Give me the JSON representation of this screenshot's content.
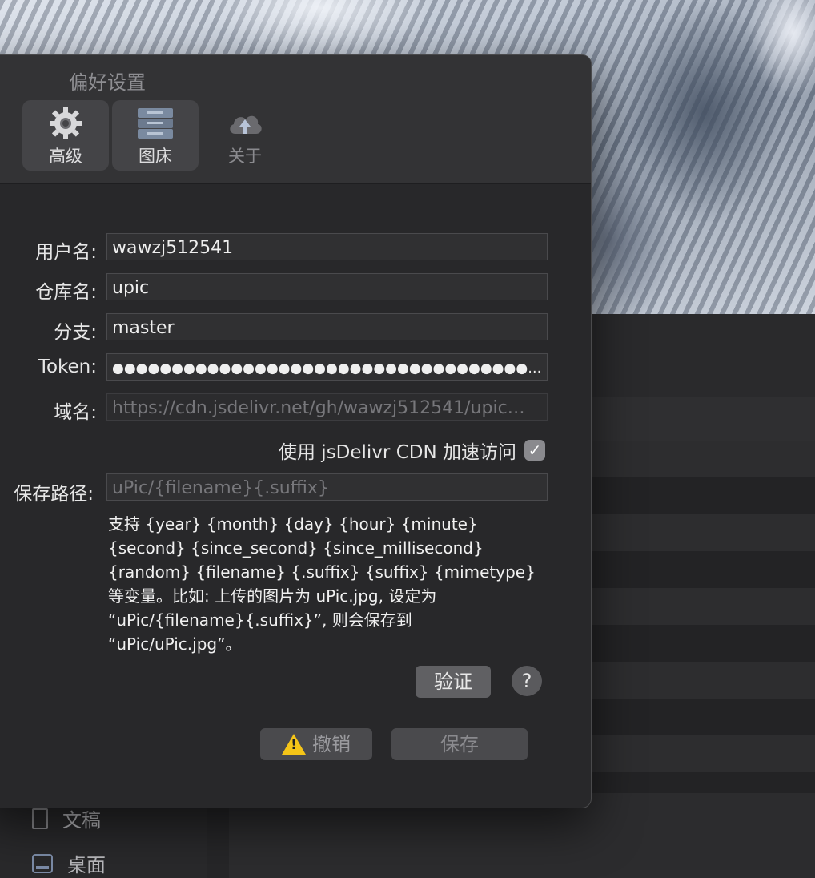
{
  "window": {
    "title": "偏好设置"
  },
  "toolbar": {
    "items": [
      {
        "label": "高级",
        "icon": "gear-icon",
        "selected": true
      },
      {
        "label": "图床",
        "icon": "server-icon",
        "selected": true
      },
      {
        "label": "关于",
        "icon": "cloud-upload-icon",
        "selected": false
      }
    ]
  },
  "form": {
    "username": {
      "label": "用户名:",
      "value": "wawzj512541"
    },
    "repo": {
      "label": "仓库名:",
      "value": "upic"
    },
    "branch": {
      "label": "分支:",
      "value": "master"
    },
    "token": {
      "label": "Token:",
      "value": "●●●●●●●●●●●●●●●●●●●●●●●●●●●●●●●●●●●●●●●●●●●●●●●●●"
    },
    "domain": {
      "label": "域名:",
      "placeholder": "https://cdn.jsdelivr.net/gh/wawzj512541/upic…"
    },
    "cdn": {
      "label": "使用 jsDelivr CDN 加速访问",
      "checked": true,
      "check_glyph": "✓"
    },
    "save_path": {
      "label": "保存路径:",
      "placeholder": "uPic/{filename}{.suffix}"
    },
    "help_text": "支持 {year} {month} {day} {hour} {minute} {second} {since_second} {since_millisecond} {random} {filename} {.suffix} {suffix} {mimetype} 等变量。比如: 上传的图片为 uPic.jpg, 设定为 “uPic/{filename}{.suffix}”, 则会保存到 “uPic/uPic.jpg”。"
  },
  "buttons": {
    "verify": "验证",
    "help": "?",
    "cancel": "撤销",
    "save": "保存"
  },
  "finder_sidebar": {
    "items": [
      {
        "label": "文稿",
        "icon": "document-icon"
      },
      {
        "label": "桌面",
        "icon": "desktop-icon"
      }
    ]
  }
}
